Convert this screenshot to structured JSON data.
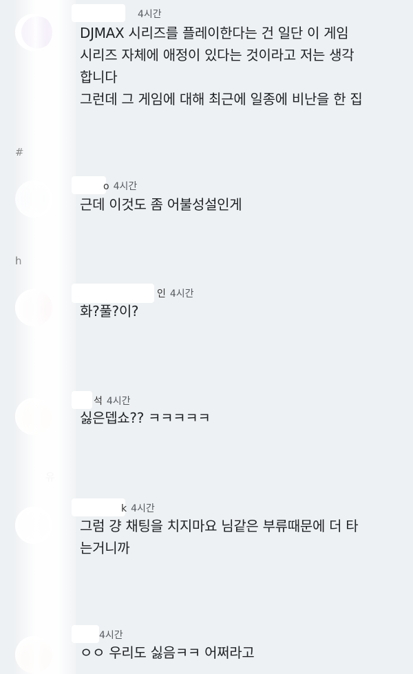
{
  "comments": [
    {
      "nick": "",
      "time": "4시간",
      "lines": [
        "DJMAX 시리즈를 플레이한다는 건 일단 이 게임",
        "시리즈 자체에 애정이 있다는 것이라고 저는 생각",
        "합니다",
        "그런데 그 게임에 대해 최근에 일종에 비난을 한 집"
      ],
      "avatar_color": "#7a22c9"
    },
    {
      "nick": "o",
      "time": "4시간",
      "lines": [
        "근데 이것도 좀 어불성설인게"
      ],
      "avatar_color": "#9aa7c8"
    },
    {
      "nick": "인",
      "time": "4시간",
      "lines": [
        "화?풀?이?"
      ],
      "avatar_color": "#d9808f"
    },
    {
      "nick": "석",
      "time": "4시간",
      "lines": [
        "싫은뎁쇼?? ㅋㅋㅋㅋㅋ"
      ],
      "avatar_color": "#d8a36b"
    },
    {
      "nick": "k",
      "time": "4시간",
      "lines": [
        "그럼 걍 채팅을 치지마요 님같은 부류때문에 더 타",
        "는거니까"
      ],
      "avatar_color": "#c9c9c9"
    },
    {
      "nick": "",
      "time": "4시간",
      "lines": [
        "ㅇㅇ 우리도 싫음ㅋㅋ 어쩌라고"
      ],
      "avatar_color": "#b8875a"
    }
  ],
  "side_fragments": [
    "#",
    "h",
    "유"
  ]
}
